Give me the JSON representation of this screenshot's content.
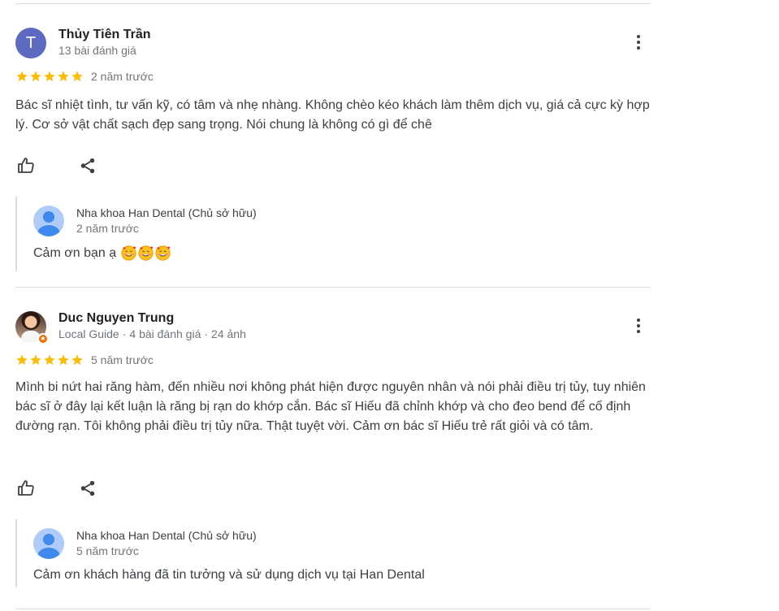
{
  "colors": {
    "star": "#fbbc04",
    "accent": "#1a73e8",
    "divider": "#dadce0",
    "secondary_text": "#70757a"
  },
  "reviews": [
    {
      "avatar_letter": "T",
      "name": "Thủy Tiên Trần",
      "meta": "13 bài đánh giá",
      "stars": 5,
      "time_ago": "2 năm trước",
      "text": "Bác sĩ nhiệt tình, tư vấn kỹ, có tâm và nhẹ nhàng. Không chèo kéo khách làm thêm dịch vụ, giá cả cực kỳ hợp lý. Cơ sở vật chất sạch đẹp sang trọng. Nói chung là không có gì để chê",
      "reply": {
        "owner": "Nha khoa Han Dental (Chủ sở hữu)",
        "time_ago": "2 năm trước",
        "text": "Cảm ơn bạn ạ",
        "emoji": [
          "smiling-face-with-hearts-emoji",
          "smiling-face-with-hearts-emoji",
          "smiling-face-with-hearts-emoji"
        ]
      }
    },
    {
      "name": "Duc Nguyen Trung",
      "meta_guide": "Local Guide",
      "meta_reviews": "4 bài đánh giá",
      "meta_photos": "24 ảnh",
      "meta_separator": "·",
      "stars": 5,
      "time_ago": "5 năm trước",
      "text": "Mình bi nứt hai răng hàm, đến nhiều nơi không phát hiện được nguyên nhân và nói phải điều trị tủy, tuy nhiên bác sĩ ở đây lại kết luận là răng bị rạn do khớp cắn. Bác sĩ Hiếu đã chỉnh khớp và cho đeo bend để cố định đường rạn. Tôi không phải điều trị tủy nữa. Thật tuyệt vời. Cảm ơn bác sĩ Hiếu trẻ rất giỏi và có tâm.",
      "reply": {
        "owner": "Nha khoa Han Dental (Chủ sở hữu)",
        "time_ago": "5 năm trước",
        "text": "Cảm ơn khách hàng đã tin tưởng và sử dụng dịch vụ tại Han Dental"
      }
    }
  ],
  "icons": [
    "more-vert-icon",
    "thumb-up-icon",
    "share-icon",
    "star-icon",
    "person-icon"
  ]
}
